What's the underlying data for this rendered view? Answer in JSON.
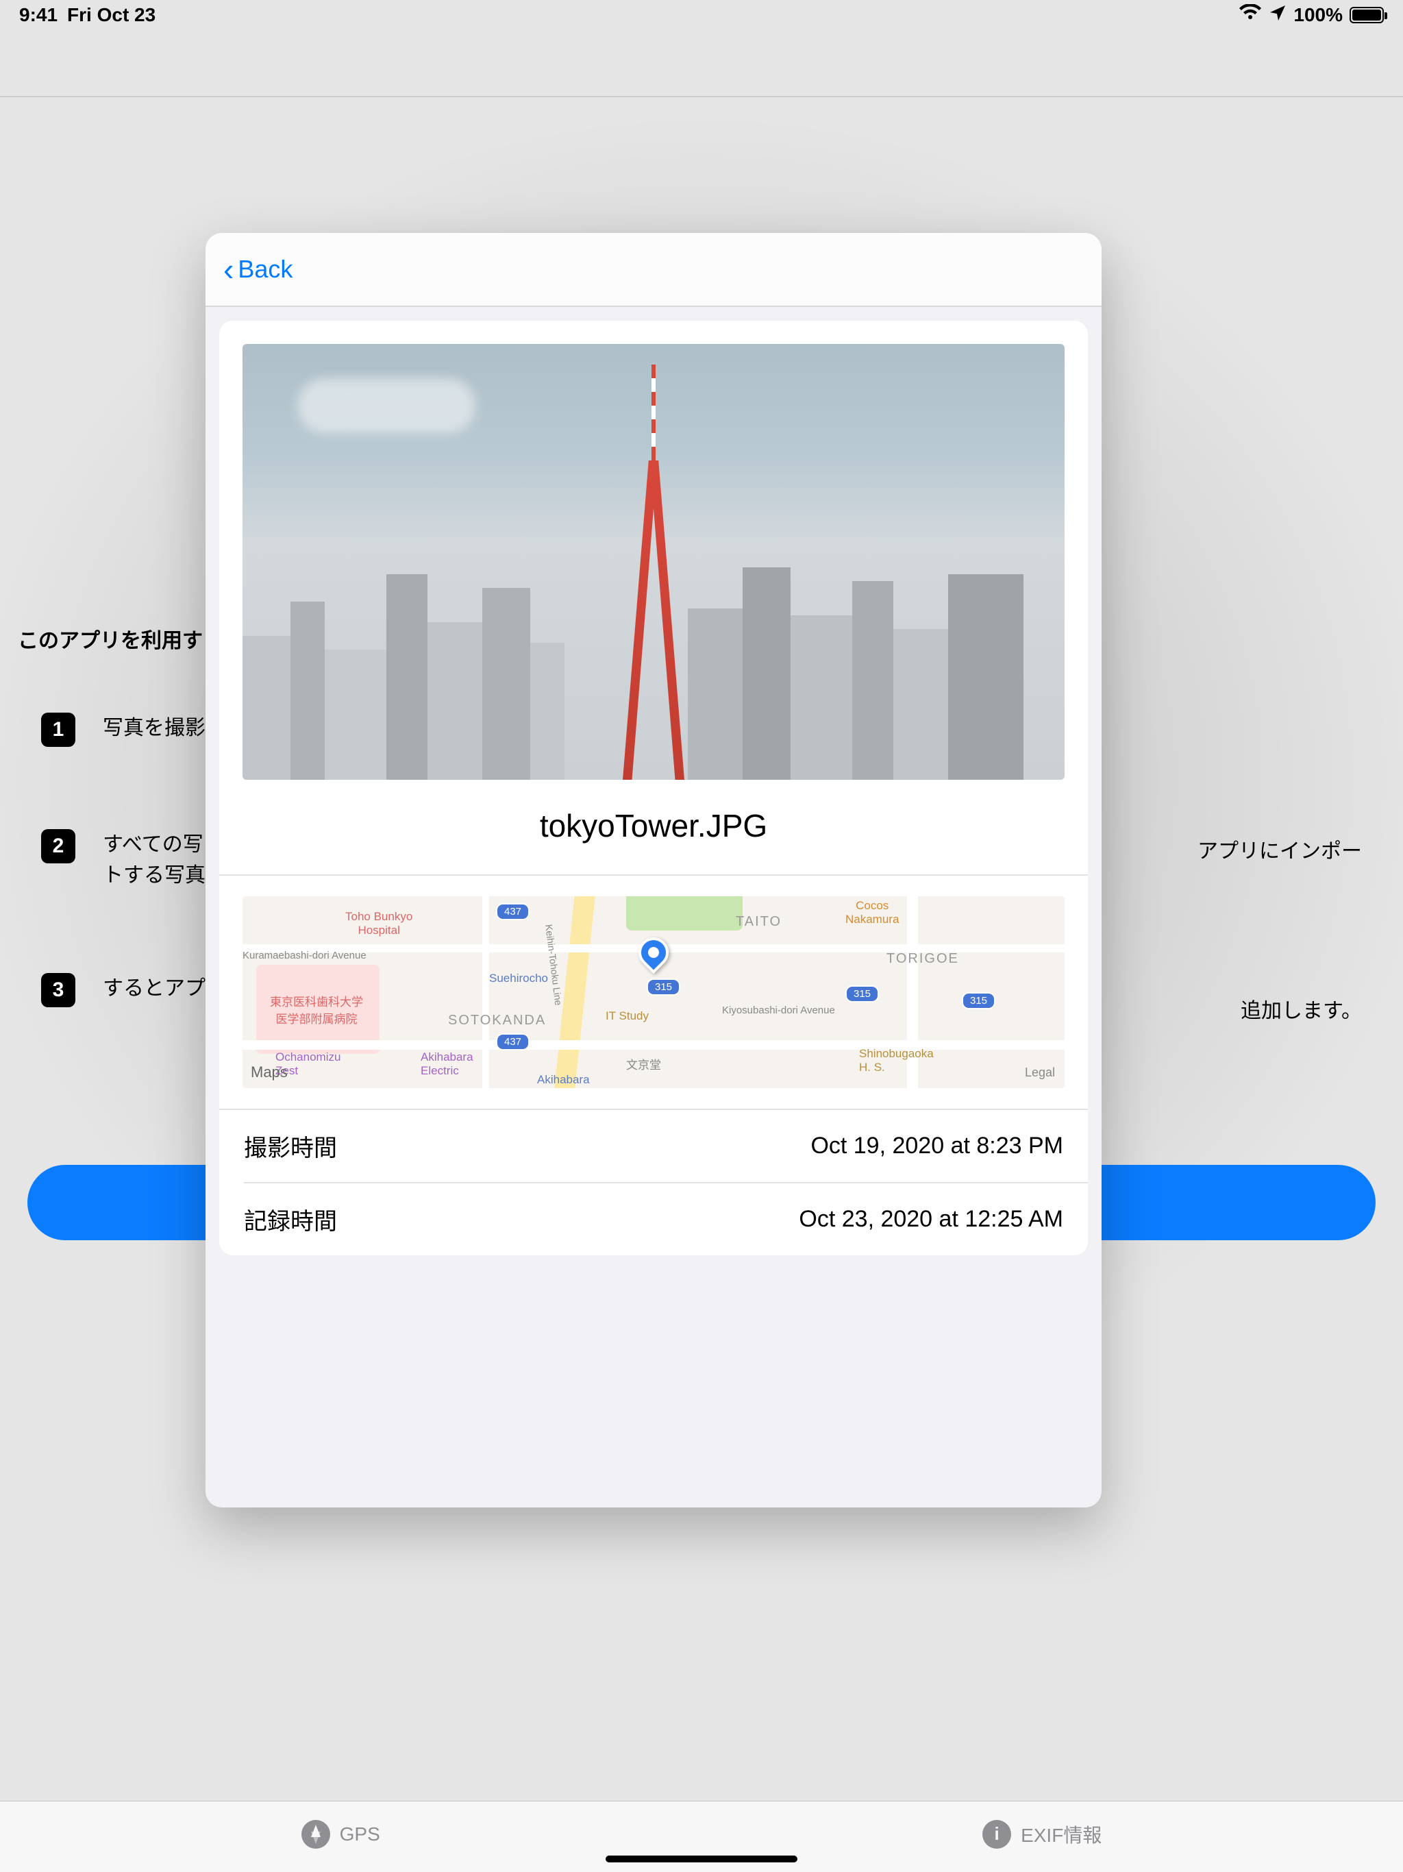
{
  "status": {
    "time": "9:41",
    "date": "Fri Oct 23",
    "battery": "100%"
  },
  "bg": {
    "intro": "このアプリを利用す",
    "steps": {
      "s1": "写真を撮影",
      "s2": "すべての写\nトする写真",
      "s2r": "アプリにインポー",
      "s3": "するとアプ",
      "s3r": "追加します。"
    }
  },
  "modal": {
    "back": "Back",
    "photo_filename": "tokyoTower.JPG",
    "maps_label": "Maps",
    "maps_legal": "Legal",
    "mbadges": {
      "b437a": "437",
      "b437b": "437",
      "b315a": "315",
      "b315b": "315",
      "b315c": "315"
    },
    "areas": {
      "sotokanda": "SOTOKANDA",
      "taito": "TAITO",
      "torigoe": "TORIGOE"
    },
    "places": {
      "bunkyo": "Toho Bunkyo\nHospital",
      "cocos": "Cocos\nNakamura",
      "suehirocho": "Suehirocho",
      "itstudy": "IT Study",
      "medschool": "東京医科歯科大学\n医学部附属病院",
      "ocha": "Ochanomizu\nZest",
      "akiba": "Akihabara\nElectric",
      "akiba2": "Akihabara",
      "bunkyodori": "文京堂",
      "shino": "Shinobugaoka\nH. S.",
      "kuramae": "Kuramaebashi-dori Avenue",
      "kiyosu": "Kiyosubashi-dori Avenue",
      "tohoku": "Keihin-Tohoku Line"
    },
    "rows": [
      {
        "label": "撮影時間",
        "value": "Oct 19, 2020 at 8:23 PM"
      },
      {
        "label": "記録時間",
        "value": "Oct 23, 2020 at 12:25 AM"
      }
    ]
  },
  "tabs": {
    "gps": "GPS",
    "exif": "EXIF情報"
  }
}
